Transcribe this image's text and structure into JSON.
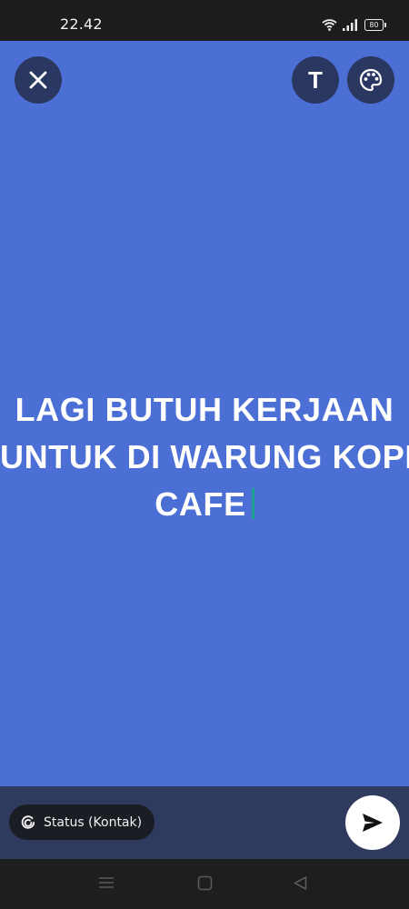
{
  "status_bar": {
    "time": "22.42",
    "battery": "80"
  },
  "theme": {
    "canvas_background": "#4c6fd6",
    "caret_color": "#1aa58a"
  },
  "toolbar": {
    "close_icon": "close-icon",
    "text_style_label": "T",
    "palette_icon": "palette-icon"
  },
  "status_text": {
    "lines": [
      "LAGI BUTUH KERJAAN",
      "UNTUK DI WARUNG KOPI/",
      "CAFE"
    ]
  },
  "bottom": {
    "audience_label": "Status (Kontak)",
    "send_icon": "send-icon"
  },
  "nav": {
    "items": [
      "menu-icon",
      "home-icon",
      "back-icon"
    ]
  }
}
